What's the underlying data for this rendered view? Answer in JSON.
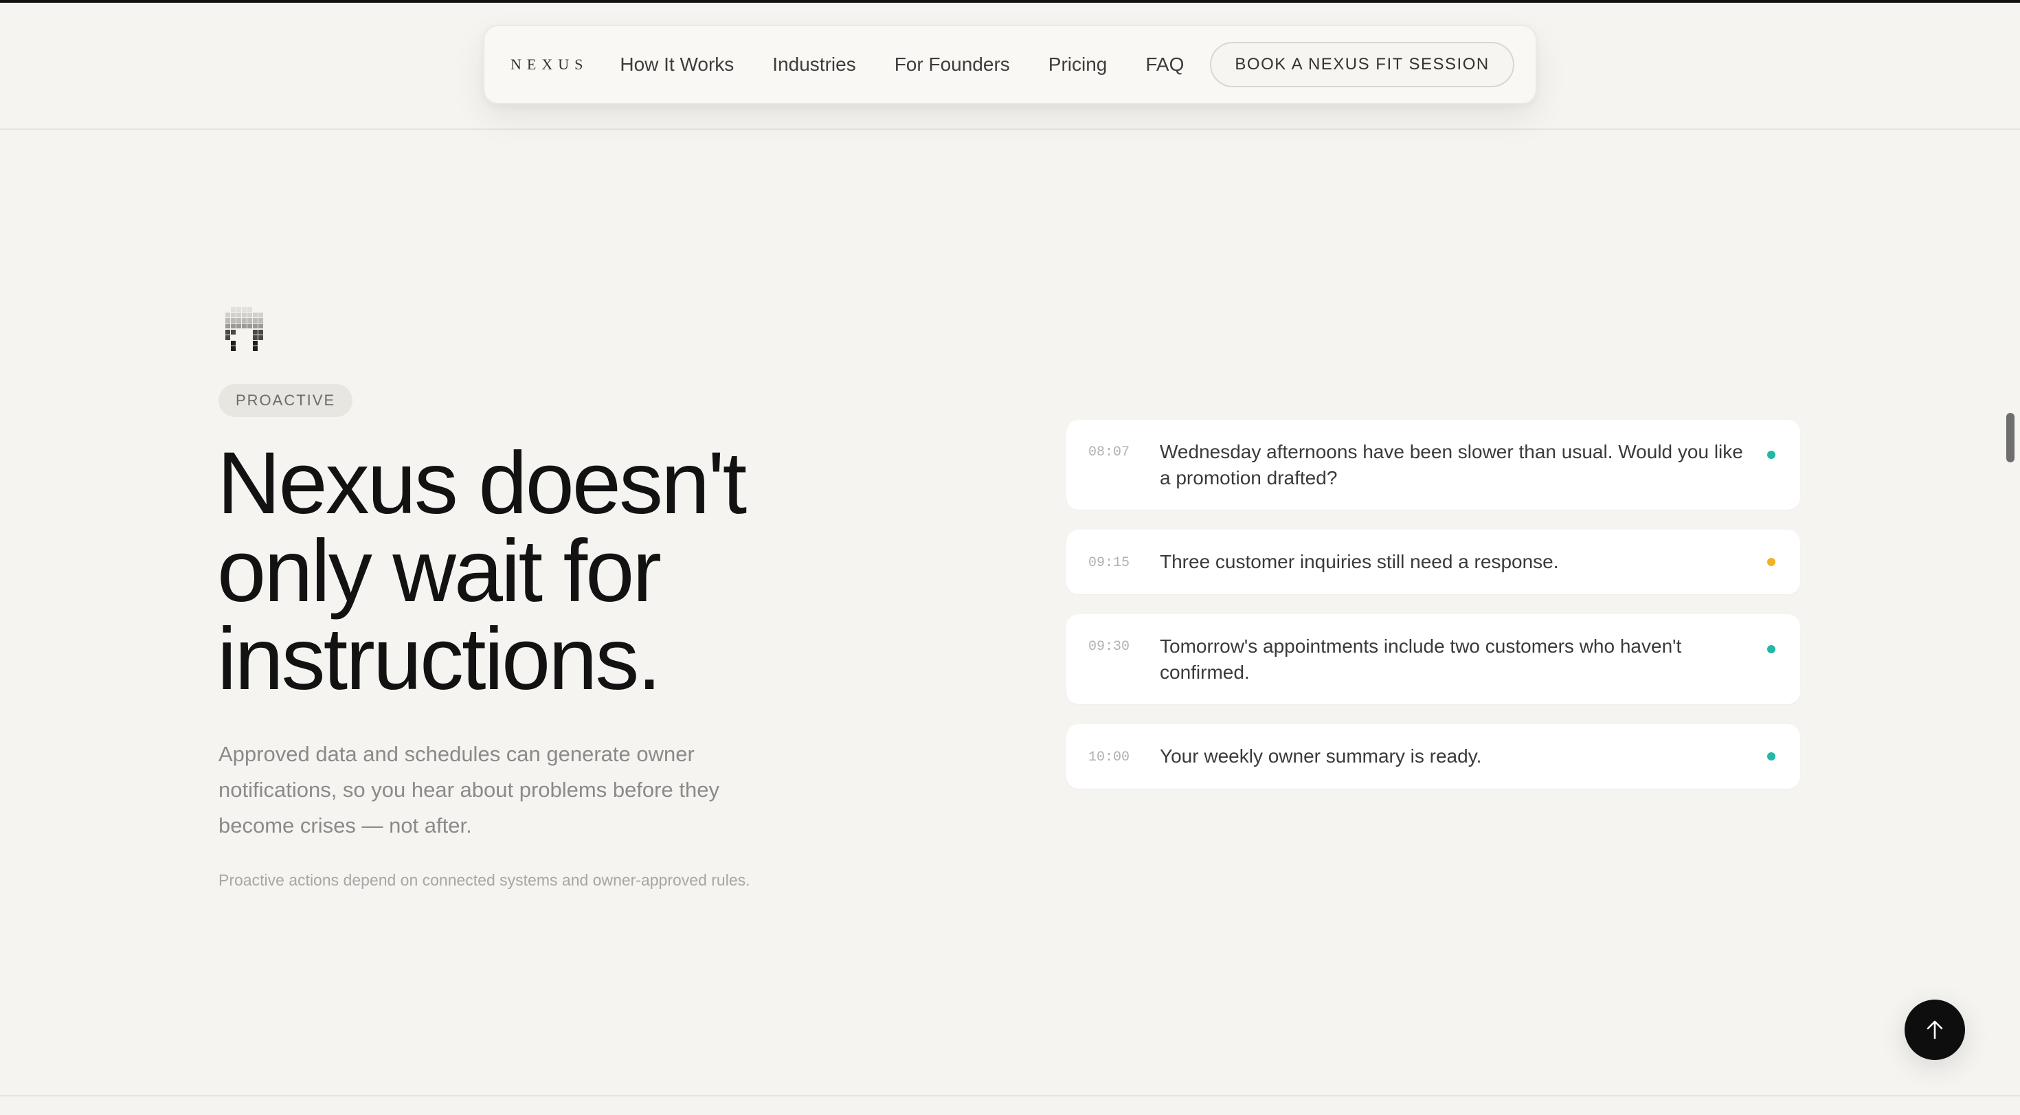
{
  "nav": {
    "logo": "NEXUS",
    "links": [
      "How It Works",
      "Industries",
      "For Founders",
      "Pricing",
      "FAQ"
    ],
    "cta": "BOOK A NEXUS FIT SESSION"
  },
  "hero": {
    "icon": "pixel-robot-icon",
    "tag": "PROACTIVE",
    "headline": "Nexus doesn't only wait for instructions.",
    "lead": "Approved data and schedules can generate owner notifications, so you hear about problems before they become crises — not after.",
    "note": "Proactive actions depend on connected systems and owner-approved rules."
  },
  "notifications": [
    {
      "time": "08:07",
      "text": "Wednesday afternoons have been slower than usual. Would you like a promotion drafted?",
      "status_color": "#22b8a7"
    },
    {
      "time": "09:15",
      "text": "Three customer inquiries still need a response.",
      "status_color": "#f0b323"
    },
    {
      "time": "09:30",
      "text": "Tomorrow's appointments include two customers who haven't confirmed.",
      "status_color": "#22b8a7"
    },
    {
      "time": "10:00",
      "text": "Your weekly owner summary is ready.",
      "status_color": "#22b8a7"
    }
  ],
  "back_to_top": {
    "icon": "arrow-up-icon"
  }
}
